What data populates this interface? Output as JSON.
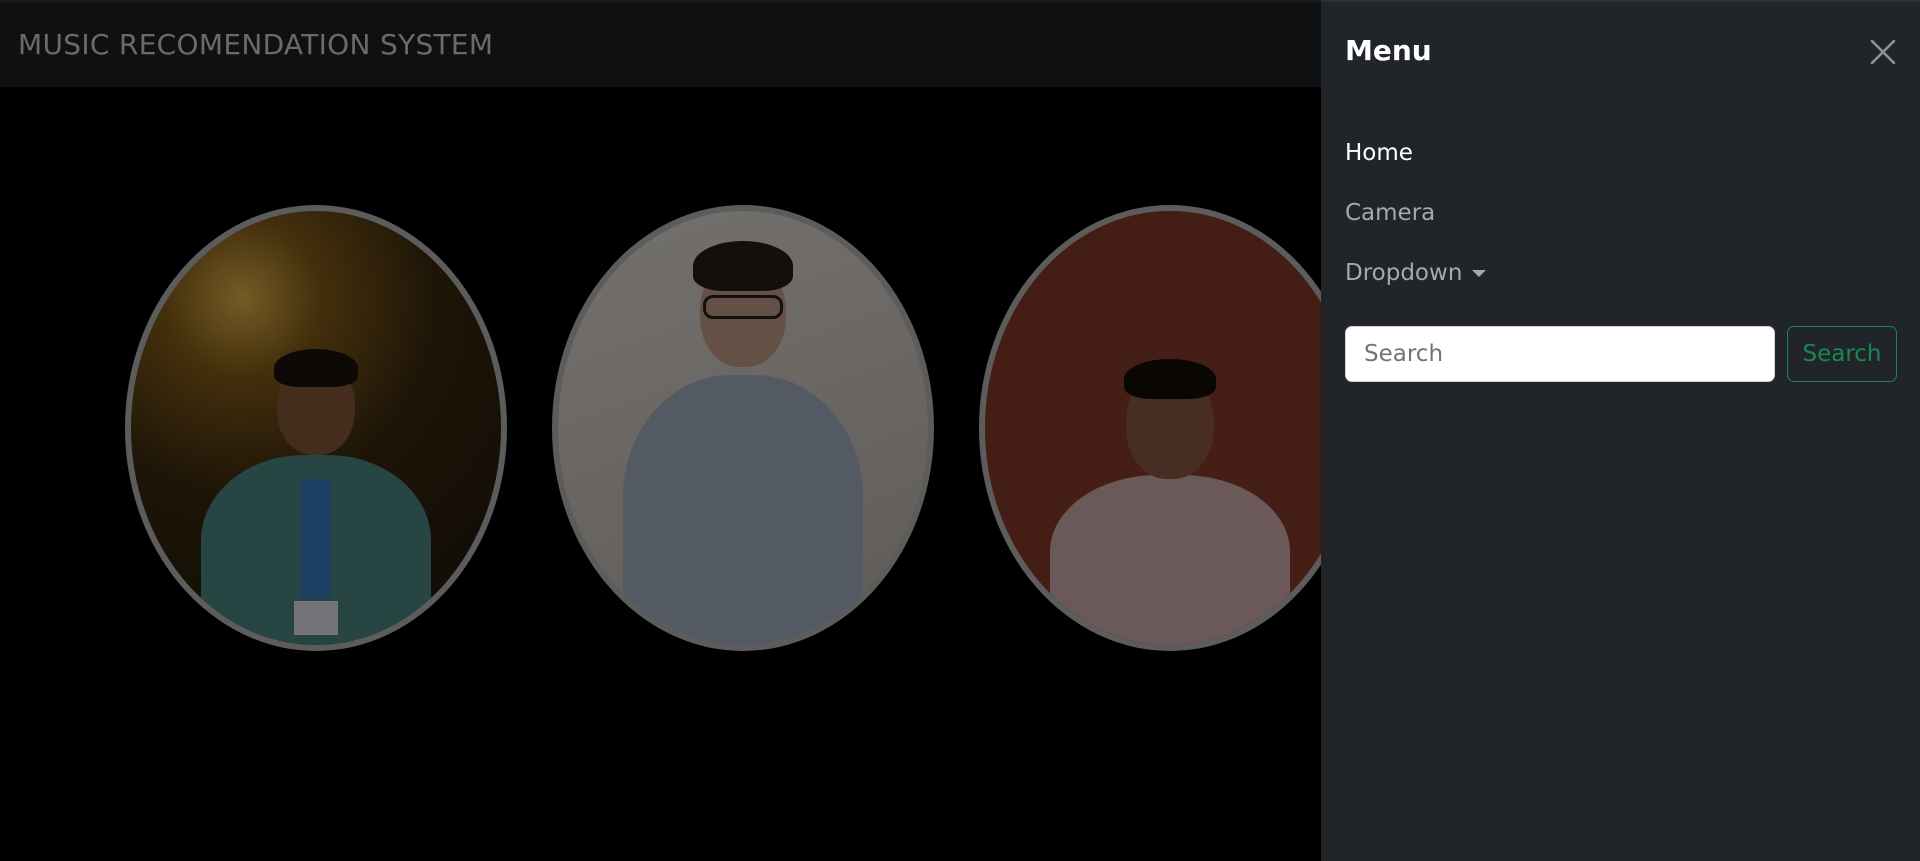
{
  "navbar": {
    "brand": "MUSIC RECOMENDATION SYSTEM"
  },
  "team": {
    "photos": [
      {
        "name": "team-member-photo-1"
      },
      {
        "name": "team-member-photo-2"
      },
      {
        "name": "team-member-photo-3"
      }
    ]
  },
  "offcanvas": {
    "title": "Menu",
    "close_icon": "close-icon",
    "nav": {
      "home": "Home",
      "camera": "Camera",
      "dropdown": "Dropdown"
    },
    "search": {
      "placeholder": "Search",
      "button_label": "Search"
    }
  },
  "colors": {
    "accent": "#198754",
    "offcanvas_bg": "#212529",
    "navbar_bg": "#1d2023"
  }
}
